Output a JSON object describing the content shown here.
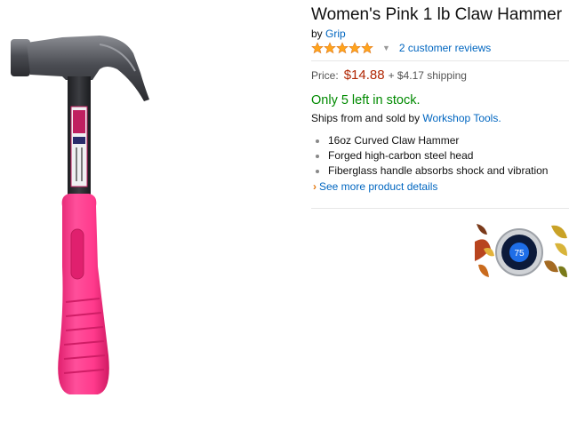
{
  "product": {
    "title": "Women's Pink 1 lb Claw Hammer",
    "by_prefix": "by",
    "brand": "Grip",
    "rating_stars": 5,
    "rating_icon": "star-icon",
    "reviews_link": "2 customer reviews",
    "price_label": "Price:",
    "price": "$14.88",
    "shipping": "+ $4.17 shipping",
    "stock": "Only 5 left in stock.",
    "ships_prefix": "Ships from and sold by",
    "seller": "Workshop Tools.",
    "features": [
      "16oz Curved Claw Hammer",
      "Forged high-carbon steel head",
      "Fiberglass handle absorbs shock and vibration"
    ],
    "see_more": "See more product details"
  },
  "ad": {
    "thermostat_reading": "75"
  },
  "colors": {
    "link": "#0066c0",
    "price": "#b12704",
    "stock": "#008a00",
    "star": "#ffa41c",
    "handle": "#ff3a8c"
  }
}
